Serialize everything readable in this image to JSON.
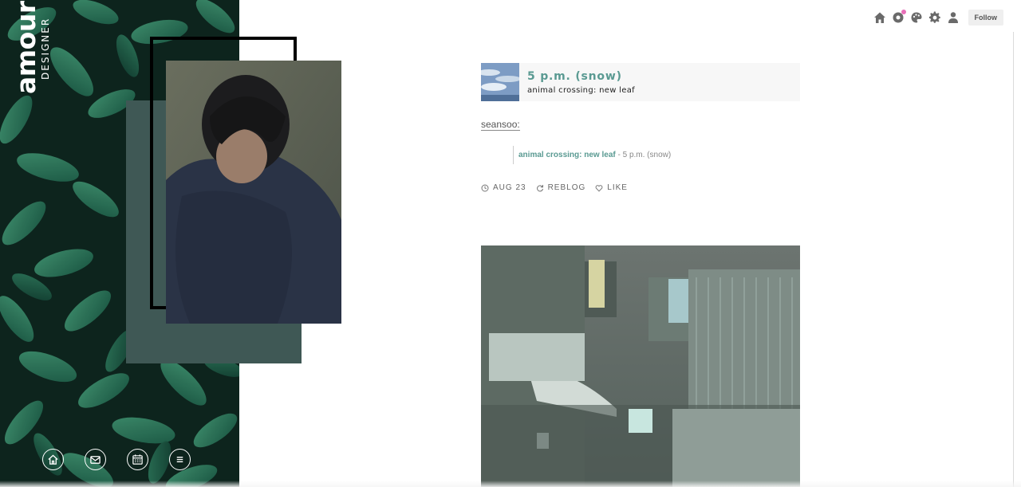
{
  "brand": {
    "title": "amour",
    "subtitle": "DESIGNER"
  },
  "side_nav": [
    {
      "icon": "home-icon"
    },
    {
      "icon": "mail-icon"
    },
    {
      "icon": "calendar-icon"
    },
    {
      "icon": "menu-icon"
    }
  ],
  "topbar": {
    "icons": [
      "home-icon",
      "activity-icon",
      "palette-icon",
      "gear-icon",
      "account-icon"
    ],
    "follow_label": "Follow"
  },
  "post": {
    "track_title": "5 p.m. (snow)",
    "track_artist": "animal crossing: new leaf",
    "reblogger": "seansoo:",
    "quote_link": "animal crossing: new leaf",
    "quote_rest": " - 5 p.m. (snow)",
    "date": "AUG 23",
    "reblog_label": "REBLOG",
    "like_label": "LIKE"
  },
  "colors": {
    "accent": "#5a9a92",
    "sidebar_bg": "#0f2a22",
    "collage_back": "#3f5855",
    "notif_dot": "#e86fb8"
  }
}
